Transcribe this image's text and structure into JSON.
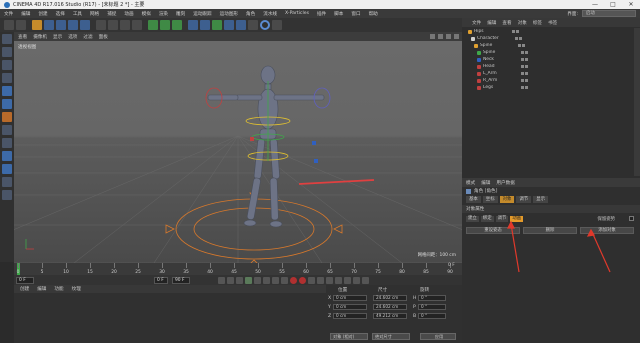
{
  "window": {
    "title": "CINEMA 4D R17.016 Studio (R17) - [未标题 2 *] - 主要",
    "controls": [
      "—",
      "□",
      "✕"
    ]
  },
  "menubar": {
    "items": [
      "文件",
      "编辑",
      "创建",
      "选择",
      "工具",
      "网格",
      "捕捉",
      "动画",
      "模拟",
      "渲染",
      "雕刻",
      "运动跟踪",
      "运动图形",
      "角色",
      "流水线",
      "X-Particles",
      "插件",
      "脚本",
      "窗口",
      "帮助"
    ],
    "layout_label": "界面:",
    "layout_value": "启动"
  },
  "toolbar": {
    "icons": [
      "undo-icon",
      "redo-icon",
      "select-icon",
      "move-icon",
      "scale-icon",
      "rotate-icon",
      "live-select-icon",
      "x-axis-icon",
      "y-axis-icon",
      "z-axis-icon",
      "coordinate-icon",
      "render-view-icon",
      "render-picture-icon",
      "render-settings-icon",
      "cube-icon",
      "pen-icon",
      "subdivide-icon",
      "array-icon",
      "deformer-icon",
      "floor-icon",
      "camera-icon",
      "light-icon"
    ]
  },
  "viewport": {
    "menu": [
      "查看",
      "摄像机",
      "显示",
      "选项",
      "过滤",
      "面板"
    ],
    "label": "透视视图",
    "grid_distance": "网格间距：100 cm"
  },
  "timeline": {
    "ticks": [
      "0",
      "5",
      "10",
      "15",
      "20",
      "25",
      "30",
      "35",
      "40",
      "45",
      "50",
      "55",
      "60",
      "65",
      "70",
      "75",
      "80",
      "85",
      "90"
    ],
    "end_label": "0 F",
    "current_frame": "0 F",
    "start_frame": "0 F",
    "end_frame": "90 F",
    "max_frame": "90 F"
  },
  "lower_panel": {
    "menu": [
      "创建",
      "编辑",
      "功能",
      "纹理"
    ]
  },
  "coordinates": {
    "headers": [
      "位置",
      "尺寸",
      "旋转"
    ],
    "rows": [
      {
        "axis": "X",
        "pos": "0 cm",
        "size": "24.602 cm",
        "rot_label": "H",
        "rot": "0 °"
      },
      {
        "axis": "Y",
        "pos": "0 cm",
        "size": "24.602 cm",
        "rot_label": "P",
        "rot": "0 °"
      },
      {
        "axis": "Z",
        "pos": "0 cm",
        "size": "49.212 cm",
        "rot_label": "B",
        "rot": "0 °"
      }
    ],
    "mode": "对象 (相对)",
    "size_mode": "绝对尺寸",
    "apply": "应用"
  },
  "object_manager": {
    "menu": [
      "文件",
      "编辑",
      "查看",
      "对象",
      "标签",
      "书签"
    ],
    "items": [
      {
        "name": "Hips",
        "color": "#e0a030"
      },
      {
        "name": "Character",
        "color": "#cfcfcf"
      },
      {
        "name": "Spine",
        "color": "#e0a030"
      },
      {
        "name": "Spine",
        "color": "#3fa84a"
      },
      {
        "name": "Neck",
        "color": "#3060c0"
      },
      {
        "name": "Head",
        "color": "#c04040"
      },
      {
        "name": "L_Arm",
        "color": "#c04040"
      },
      {
        "name": "R_Arm",
        "color": "#c04040"
      },
      {
        "name": "Legs",
        "color": "#c04040"
      }
    ]
  },
  "attributes": {
    "menu": [
      "模式",
      "编辑",
      "用户数据"
    ],
    "object_label": "角色 [角色]",
    "tabs": [
      "基本",
      "坐标",
      "对象",
      "调节",
      "显示"
    ],
    "active_tab": "对象",
    "section": "对象属性",
    "pills": [
      "建立",
      "绑定",
      "调节",
      "动画"
    ],
    "active_pill": "动画",
    "rest_label": "保留姿势",
    "buttons": [
      "重设姿态",
      "删除",
      "添加对象"
    ]
  },
  "colors": {
    "accent": "#c58b2b",
    "annotation": "#e0392b"
  }
}
